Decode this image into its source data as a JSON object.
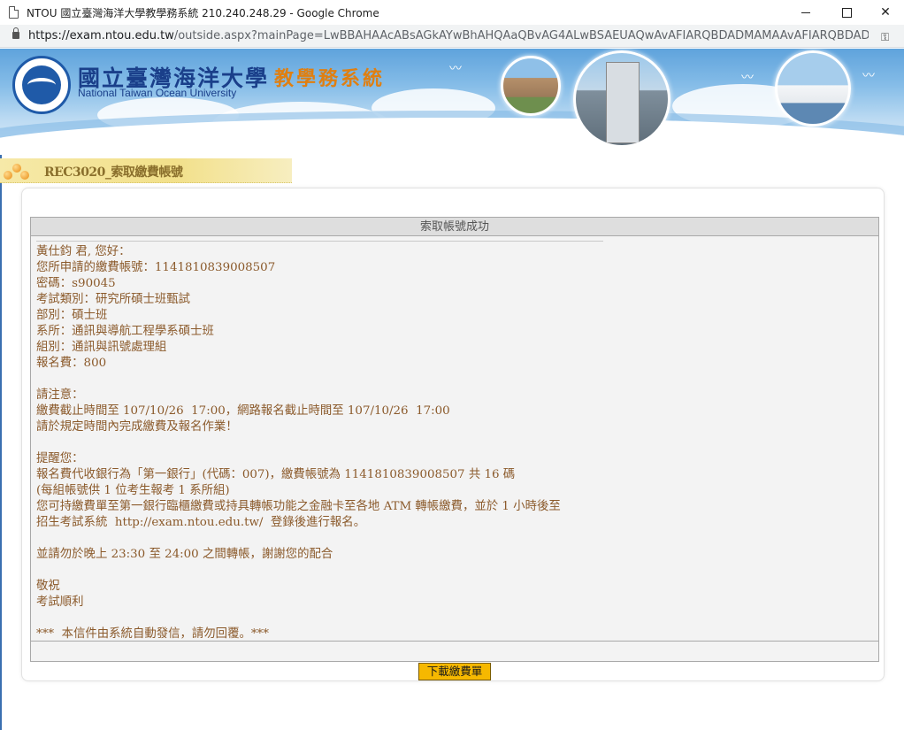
{
  "window": {
    "title": "NTOU 國立臺灣海洋大學教學務系統 210.240.248.29 - Google Chrome",
    "url_host": "https://exam.ntou.edu.tw",
    "url_path": "/outside.aspx?mainPage=LwBBAHAAcABsAGkAYwBhAHQAaQBvAG4ALwBSAEUAQwAvAFIARQBDADMAMAAvAFIARQBDADMA..."
  },
  "banner": {
    "university_zh": "國立臺灣海洋大學",
    "university_en": "National Taiwan Ocean University",
    "system_name": "教學務系統"
  },
  "page_tag": {
    "label": "REC3020_索取繳費帳號"
  },
  "result": {
    "header": "索取帳號成功",
    "lines": [
      "黃仕鈞 君, 您好：",
      "您所申請的繳費帳號：1141810839008507",
      "密碼：s90045",
      "考試類別：研究所碩士班甄試",
      "部別：碩士班",
      "系所：通訊與導航工程學系碩士班",
      "組別：通訊與訊號處理組",
      "報名費：800",
      "",
      "請注意：",
      "繳費截止時間至 107/10/26  17:00，網路報名截止時間至 107/10/26  17:00",
      "請於規定時間內完成繳費及報名作業！",
      "",
      "提醒您：",
      "報名費代收銀行為「第一銀行」(代碼：007)，繳費帳號為 1141810839008507 共 16 碼",
      "(每組帳號供 1 位考生報考 1 系所組)",
      "您可持繳費單至第一銀行臨櫃繳費或持具轉帳功能之金融卡至各地 ATM 轉帳繳費，並於 1 小時後至",
      "招生考試系統  http://exam.ntou.edu.tw/  登錄後進行報名。",
      "",
      "並請勿於晚上 23:30 至 24:00 之間轉帳，謝謝您的配合",
      "",
      "敬祝",
      "考試順利",
      "",
      "***  本信件由系統自動發信，請勿回覆。***"
    ]
  },
  "buttons": {
    "download": "下載繳費單"
  }
}
